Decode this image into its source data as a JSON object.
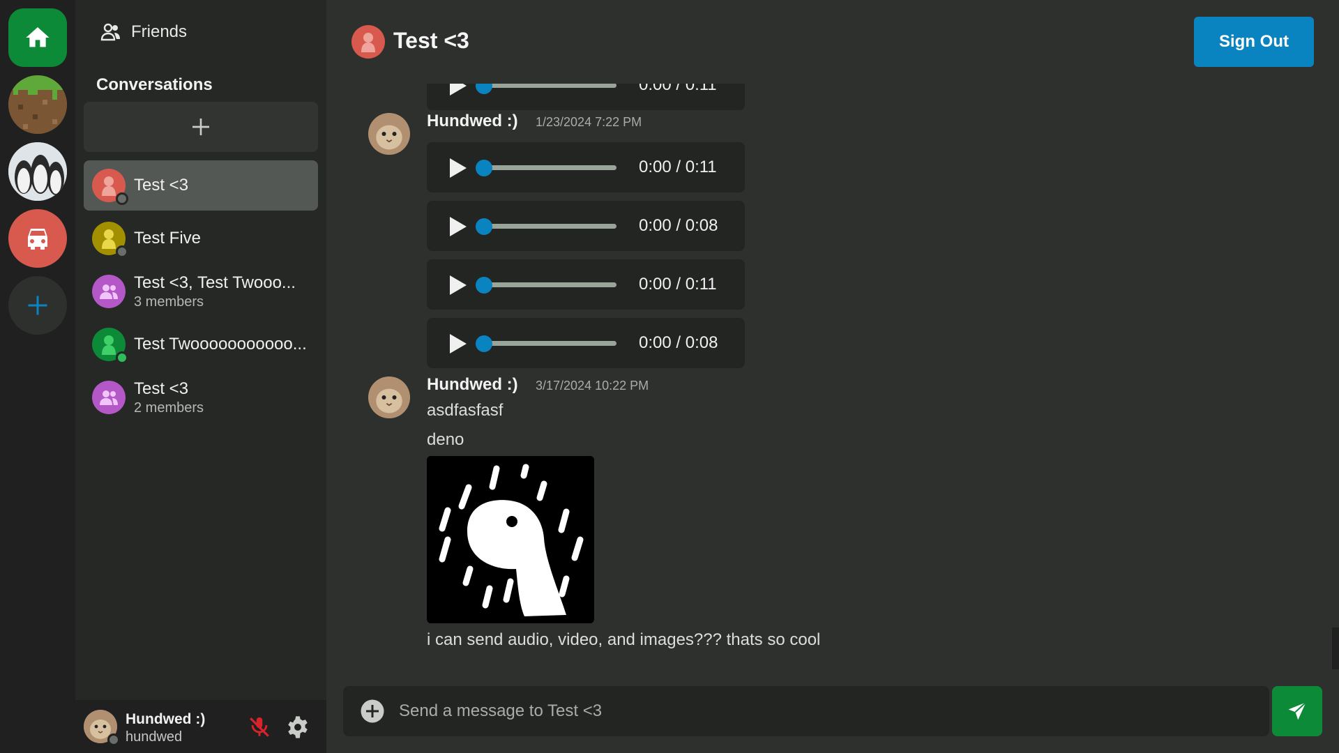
{
  "rail": {
    "servers": [
      {
        "name": "home",
        "icon": "home-icon",
        "color": "#0d8a38"
      },
      {
        "name": "grass-block",
        "icon": "grass-block-icon",
        "color": "#7a5634"
      },
      {
        "name": "penguins",
        "icon": "penguin-icon",
        "color": "#cfd6dc"
      },
      {
        "name": "car",
        "icon": "car-icon",
        "color": "#d85a4f"
      },
      {
        "name": "add-server",
        "icon": "plus-icon",
        "color": "#0a84c0"
      }
    ]
  },
  "sidebar": {
    "friends_label": "Friends",
    "conversations_heading": "Conversations",
    "new_conversation_icon": "plus-icon",
    "conversations": [
      {
        "name": "Test <3",
        "sub": "",
        "color": "#d85a4f",
        "type": "user",
        "status": "offline",
        "active": true
      },
      {
        "name": "Test Five",
        "sub": "",
        "color": "#a39000",
        "type": "user",
        "status": "offline",
        "active": false
      },
      {
        "name": "Test <3, Test Twooo...",
        "sub": "3 members",
        "color": "#b458c8",
        "type": "group",
        "active": false
      },
      {
        "name": "Test Twooooooooooo...",
        "sub": "",
        "color": "#0d8a38",
        "type": "user",
        "status": "online",
        "active": false
      },
      {
        "name": "Test <3",
        "sub": "2 members",
        "color": "#b458c8",
        "type": "group",
        "active": false
      }
    ]
  },
  "user": {
    "display_name": "Hundwed :)",
    "username": "hundwed",
    "mic_state": "muted",
    "mute_color": "#d9232b"
  },
  "header": {
    "title": "Test <3",
    "sign_out": "Sign Out"
  },
  "messages": [
    {
      "author": "Hundwed :)",
      "timestamp": "1/23/2024 7:22 PM",
      "audio": [
        "0:00 / 0:11",
        "0:00 / 0:08",
        "0:00 / 0:11",
        "0:00 / 0:08"
      ]
    },
    {
      "author": "Hundwed :)",
      "timestamp": "3/17/2024 10:22 PM",
      "lines": [
        "asdfasfasf",
        "deno"
      ],
      "image": "deno-logo",
      "caption": "i can send audio, video, and images??? thats so cool"
    }
  ],
  "partial_audio_time": "0:00 / 0:11",
  "composer": {
    "placeholder": "Send a message to Test <3"
  },
  "colors": {
    "accent_blue": "#0a84c0",
    "accent_green": "#0d8a38"
  }
}
